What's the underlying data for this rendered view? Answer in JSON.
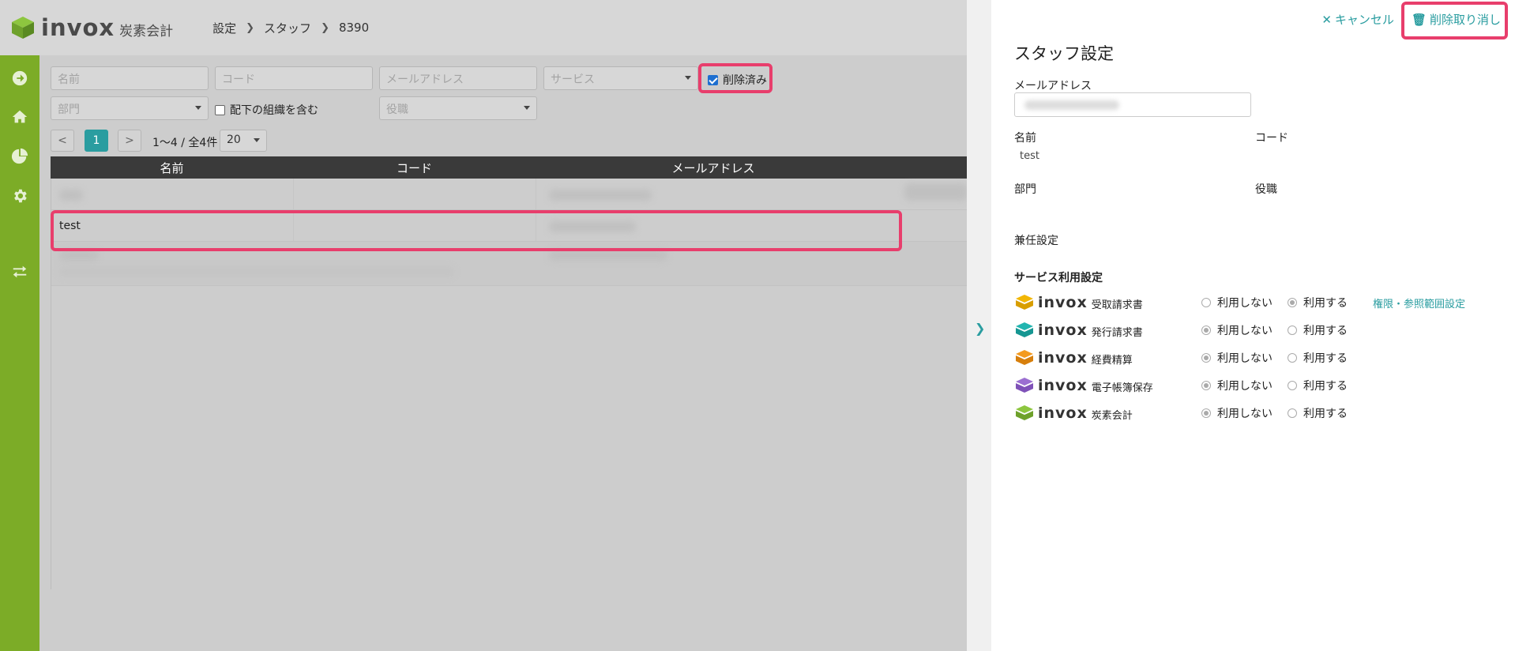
{
  "header": {
    "brand": "invox",
    "product": "炭素会計",
    "breadcrumb": [
      "設定",
      "スタッフ",
      "8390"
    ]
  },
  "filters": {
    "name_placeholder": "名前",
    "code_placeholder": "コード",
    "email_placeholder": "メールアドレス",
    "service_placeholder": "サービス",
    "deleted_label": "削除済み",
    "deleted_checked": true,
    "department_placeholder": "部門",
    "include_sub_label": "配下の組織を含む",
    "position_placeholder": "役職"
  },
  "pager": {
    "prev": "<",
    "page": "1",
    "next": ">",
    "info": "1〜4 / 全4件",
    "per_page": "20"
  },
  "table": {
    "columns": [
      "名前",
      "コード",
      "メールアドレス"
    ],
    "rows": [
      {
        "name": "test",
        "code": "",
        "email": ""
      }
    ]
  },
  "panel": {
    "cancel_label": "キャンセル",
    "undo_delete_label": "削除取り消し",
    "title": "スタッフ設定",
    "email_label": "メールアドレス",
    "name_label": "名前",
    "name_value": "test",
    "code_label": "コード",
    "department_label": "部門",
    "position_label": "役職",
    "concurrent_label": "兼任設定",
    "service_section": "サービス利用設定",
    "opt_off": "利用しない",
    "opt_on": "利用する",
    "permission_link": "権限・参照範囲設定",
    "services": [
      {
        "brand": "invox",
        "name": "受取請求書",
        "color": "#f2b705",
        "value": "on"
      },
      {
        "brand": "invox",
        "name": "発行請求書",
        "color": "#22b5b0",
        "value": "off"
      },
      {
        "brand": "invox",
        "name": "経費精算",
        "color": "#f39a1f",
        "value": "off"
      },
      {
        "brand": "invox",
        "name": "電子帳簿保存",
        "color": "#9b6fd1",
        "value": "off"
      },
      {
        "brand": "invox",
        "name": "炭素会計",
        "color": "#8dc63f",
        "value": "off"
      }
    ]
  },
  "colors": {
    "accent": "#2a9da0",
    "sidebar": "#7cac27",
    "highlight": "#e83e6c"
  }
}
